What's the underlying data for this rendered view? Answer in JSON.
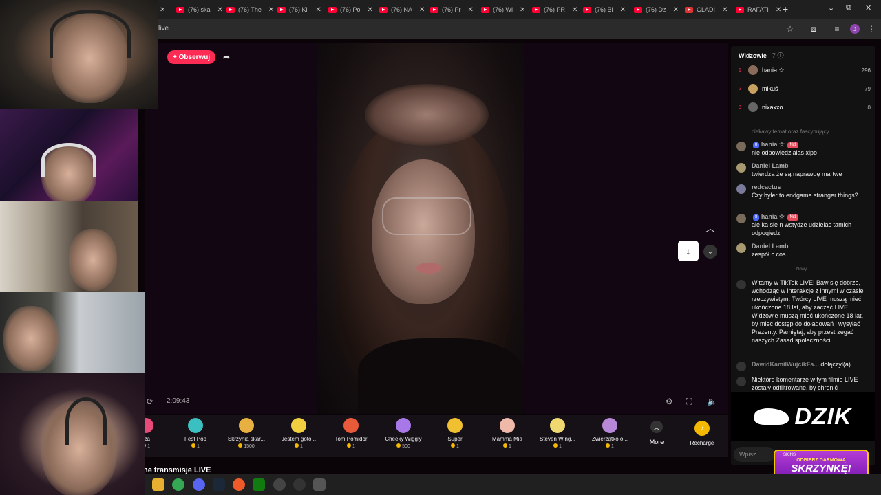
{
  "browser": {
    "tabs": [
      {
        "label": "(76) ska"
      },
      {
        "label": "(76) The"
      },
      {
        "label": "(76) Kli"
      },
      {
        "label": "(76) Po"
      },
      {
        "label": "(76) NA"
      },
      {
        "label": "(76) Pr"
      },
      {
        "label": "(76) Wi"
      },
      {
        "label": "(76) PR"
      },
      {
        "label": "(76) Bi"
      },
      {
        "label": "(76) Dz"
      },
      {
        "label": "GLADI"
      },
      {
        "label": "RAFATI"
      }
    ],
    "new_tab": "+",
    "address": "live"
  },
  "stream": {
    "follow_label": "+ Obserwuj",
    "elapsed": "2:09:43"
  },
  "gifts": [
    {
      "name": "ża",
      "price": "1"
    },
    {
      "name": "Fest Pop",
      "price": "1"
    },
    {
      "name": "Skrzynia skar...",
      "price": "1500"
    },
    {
      "name": "Jestem goto...",
      "price": "1"
    },
    {
      "name": "Tom Pomidor",
      "price": "1"
    },
    {
      "name": "Cheeky Wiggly",
      "price": "500"
    },
    {
      "name": "Super",
      "price": "1"
    },
    {
      "name": "Mamma Mia",
      "price": "1"
    },
    {
      "name": "Steven Wing...",
      "price": "1"
    },
    {
      "name": "Zwierzątko o...",
      "price": "1"
    }
  ],
  "gift_colors": [
    "#e84a7a",
    "#3ac0c0",
    "#e8b040",
    "#f0d040",
    "#e85a3a",
    "#a878e8",
    "#f0c030",
    "#f0b8a8",
    "#f0d870",
    "#b888d8"
  ],
  "more_label": "More",
  "recharge_label": "Recharge",
  "below_title": "ne transmisje LIVE",
  "viewers": {
    "title": "Widzowie",
    "count": "· 7",
    "list": [
      {
        "rank": "1",
        "name": "hania ☆",
        "score": "296"
      },
      {
        "rank": "2",
        "name": "mikuś",
        "score": "79"
      },
      {
        "rank": "3",
        "name": "nixaxxo",
        "score": "0"
      }
    ]
  },
  "chat": {
    "cut_text": "ciekawy temat oraz fascynujący",
    "messages": [
      {
        "user": "hania ☆",
        "badge1": "8",
        "badge2": "Nr1",
        "text": "nie odpowiedzialas xipo"
      },
      {
        "user": "Daniel Lamb",
        "text": "twierdzą że są naprawdę martwe"
      },
      {
        "user": "redcactus",
        "text": "Czy byler to endgame stranger things?"
      },
      {
        "user": "hania ☆",
        "badge1": "8",
        "badge2": "Nr1",
        "text": "ale ka sie n wstydze udzielac tamich odpoqiedzi"
      },
      {
        "user": "Daniel Lamb",
        "text": "zespół c cos"
      }
    ],
    "new_separator": "Nowy",
    "system_message": "Witamy w TikTok LIVE! Baw się dobrze, wchodząc w interakcje z innymi w czasie rzeczywistym. Twórcy LIVE muszą mieć ukończone 18 lat, aby zacząć LIVE. Widzowie muszą mieć ukończone 18 lat, by mieć dostęp do doładowań i wysyłać Prezenty. Pamiętaj, aby przestrzegać naszych Zasad społeczności.",
    "join_user": "DawidKamilWujcikFa...",
    "join_text": "dołączył(a)",
    "filter_notice": "Niektóre komentarze w tym filmie LIVE zostały odfiltrowane, by chronić",
    "input_placeholder": "Wpisz..."
  },
  "overlay": {
    "sponsor": "DZIK",
    "promo_brand": "SKINS",
    "promo_line1": "ODBIERZ DARMOWĄ",
    "promo_line2": "SKRZYNKĘ!"
  }
}
